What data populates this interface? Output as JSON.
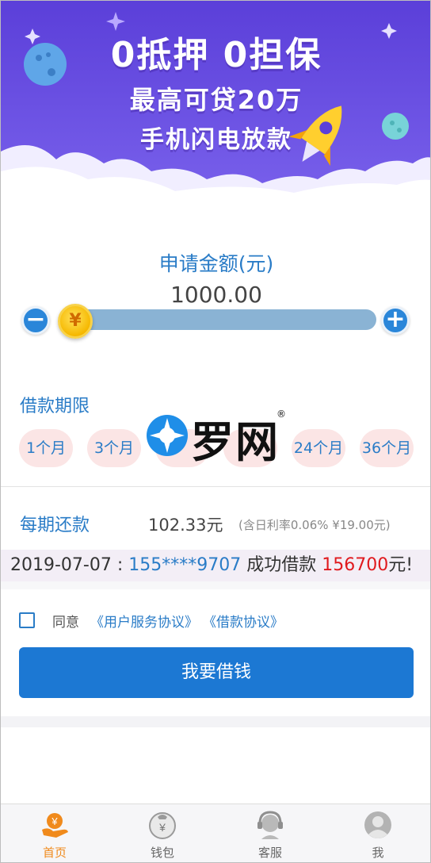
{
  "banner": {
    "line1": "0抵押 0担保",
    "line2": "最高可贷20万",
    "line3": "手机闪电放款"
  },
  "amount": {
    "title": "申请金额(元)",
    "value": "1000.00",
    "slider_level": 0.0,
    "thumb_symbol": "¥"
  },
  "term": {
    "title": "借款期限",
    "options": [
      "1个月",
      "3个月",
      "",
      "",
      "24个月",
      "36个月"
    ]
  },
  "watermark": {
    "text": "罗网",
    "reg": "®"
  },
  "repay": {
    "label": "每期还款",
    "value": "102.33元",
    "note": "(含日利率0.06% ¥19.00元)"
  },
  "marquee": {
    "date": "2019-07-07 : ",
    "phone": "155****9707",
    "middle": " 成功借款 ",
    "amount": "156700",
    "suffix": "元!"
  },
  "agreement": {
    "prefix": "同意",
    "link1": "《用户服务协议》",
    "link2": "《借款协议》"
  },
  "main_button": "我要借钱",
  "tabbar": {
    "items": [
      {
        "label": "首页",
        "icon": "home-yen-icon",
        "active": true
      },
      {
        "label": "钱包",
        "icon": "wallet-icon",
        "active": false
      },
      {
        "label": "客服",
        "icon": "customer-service-icon",
        "active": false
      },
      {
        "label": "我",
        "icon": "user-icon",
        "active": false
      }
    ]
  },
  "colors": {
    "accent": "#2a7cc7",
    "button": "#1c78d3",
    "banner_purple": "#6a4fe0",
    "highlight_red": "#e0191e",
    "tab_active": "#f08a1c"
  }
}
